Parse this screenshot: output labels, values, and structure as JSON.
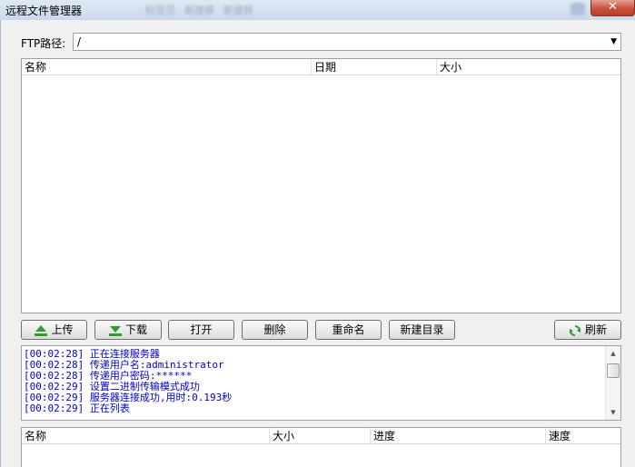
{
  "window": {
    "title": "远程文件管理器",
    "background_tabs": [
      "标签页",
      "新建移",
      "新建移"
    ],
    "close_glyph": "✕"
  },
  "ftp": {
    "label": "FTP路径:",
    "path": "/"
  },
  "remote_list": {
    "columns": [
      "名称",
      "日期",
      "大小"
    ],
    "rows": []
  },
  "toolbar": {
    "upload": "上传",
    "download": "下载",
    "open": "打开",
    "delete": "删除",
    "rename": "重命名",
    "new_folder": "新建目录",
    "refresh": "刷新"
  },
  "log": {
    "lines": [
      "[00:02:28] 正在连接服务器",
      "[00:02:28] 传递用户名:administrator",
      "[00:02:28] 传递用户密码:******",
      "[00:02:29] 设置二进制传输模式成功",
      "[00:02:29] 服务器连接成功,用时:0.193秒",
      "[00:02:29] 正在列表"
    ]
  },
  "transfer_list": {
    "columns": [
      "名称",
      "大小",
      "进度",
      "速度"
    ]
  },
  "colors": {
    "log_text": "#0000c8",
    "upload_arrow": "#2e9d2e",
    "refresh_icon": "#2e9d2e"
  },
  "icons": {
    "upload": "arrow-up-icon",
    "download": "arrow-down-icon",
    "refresh": "refresh-icon",
    "combo": "chevron-down-icon"
  }
}
